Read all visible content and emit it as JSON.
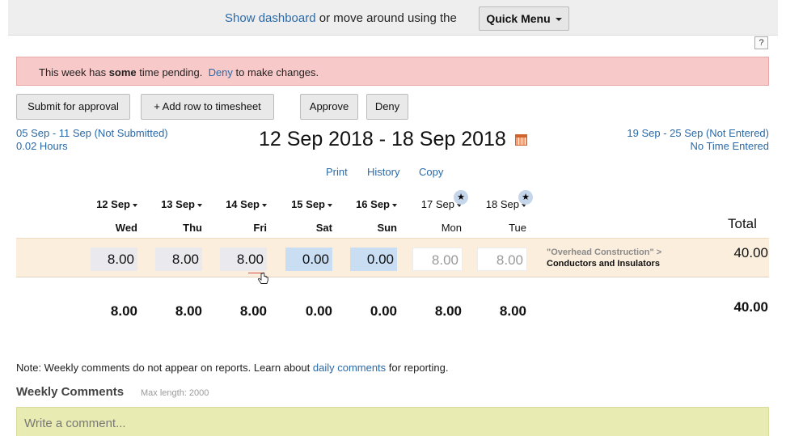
{
  "topbar": {
    "show_dashboard": "Show dashboard",
    "middle_text": " or move around using the",
    "quick_menu": "Quick Menu"
  },
  "help": "?",
  "alert": {
    "pre": "This week has ",
    "bold": "some",
    "mid": " time pending.  ",
    "deny_link": "Deny",
    "post": " to make changes."
  },
  "buttons": {
    "submit": "Submit for approval",
    "add_row": "+ Add row to timesheet",
    "approve": "Approve",
    "deny": "Deny"
  },
  "prev_week": {
    "range": "05 Sep - 11 Sep (Not Submitted)",
    "hours": "0.02 Hours"
  },
  "next_week": {
    "range": "19 Sep - 25 Sep (Not Entered)",
    "hours": "No Time Entered"
  },
  "week_title": "12 Sep 2018 - 18 Sep 2018",
  "actions": {
    "print": "Print",
    "history": "History",
    "copy": "Copy"
  },
  "days": [
    {
      "date": "12 Sep",
      "name": "Wed",
      "value": "8.00",
      "total": "8.00"
    },
    {
      "date": "13 Sep",
      "name": "Thu",
      "value": "8.00",
      "total": "8.00"
    },
    {
      "date": "14 Sep",
      "name": "Fri",
      "value": "8.00",
      "total": "8.00"
    },
    {
      "date": "15 Sep",
      "name": "Sat",
      "value": "0.00",
      "total": "0.00"
    },
    {
      "date": "16 Sep",
      "name": "Sun",
      "value": "0.00",
      "total": "0.00"
    },
    {
      "date": "17 Sep",
      "name": "Mon",
      "value": "8.00",
      "total": "8.00"
    },
    {
      "date": "18 Sep",
      "name": "Tue",
      "value": "8.00",
      "total": "8.00"
    }
  ],
  "total_label": "Total",
  "row": {
    "customer": "\"Overhead Construction\" >",
    "task": "Conductors and Insulators",
    "total": "40.00"
  },
  "grand_total": "40.00",
  "note": {
    "pre": "Note: Weekly comments do not appear on reports. Learn about ",
    "link": "daily comments",
    "post": " for reporting."
  },
  "weekly_comments": {
    "label": "Weekly Comments",
    "max_length": "Max length: 2000",
    "placeholder": "Write a comment..."
  },
  "icons": {
    "star": "★"
  }
}
